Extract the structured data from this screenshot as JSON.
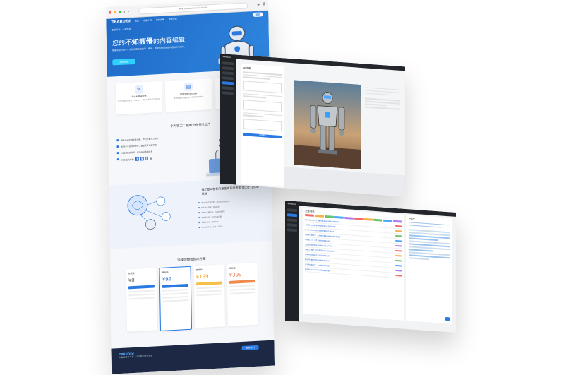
{
  "landing": {
    "url": "www.baiduzz.com/example",
    "logo": "TRAHDEd",
    "nav": [
      "首页",
      "功能介绍",
      "价格方案",
      "帮助中心"
    ],
    "nav_button": "登录",
    "hero_kicker": "智能写作 · 一键生成",
    "hero_title_pre": "您的",
    "hero_title_bold": "不知疲倦",
    "hero_title_post": "的内容编辑",
    "hero_desc": "智能AI写作助手，支持批量生成文章、图片，帮助您高效完成内容创作与发布。",
    "hero_cta": "立即体验",
    "features": [
      {
        "title": "专业AI智能写作",
        "desc": "基于大模型的智能写作能力，一键生成高质量文章内容",
        "icon": "pen-icon"
      },
      {
        "title": "批量生成SEO文章",
        "desc": "支持关键词批量生成，自动发布到网站",
        "icon": "doc-icon"
      },
      {
        "title": "AI绘画图片生成",
        "desc": "输入描述即可生成精美配图",
        "icon": "image-icon"
      }
    ],
    "section2_title": "一个内容工厂能帮您做些什么？",
    "section2_items": [
      "每天自动生成文章内容，节约大量人力成本",
      "支持多平台同步发布，覆盖更多流量渠道",
      "关键词智能拓展，提升网站收录排名"
    ],
    "counter_label": "已生成文章数",
    "counter_digits": [
      "3",
      "9",
      "6"
    ],
    "counter_unit": "篇",
    "robot_bubble": "帮您做内容 提高效率",
    "section3_title": "我们是AI智能文章生成系统专家 致力于让您更高效",
    "section3_items": [
      "支持多种文章类型，满足各类内容需求",
      "智能图文混排，自动配图",
      "支持长文章生成，内容结构清晰",
      "原创度检测，保证内容质量",
      "多语言支持，轻松出海",
      "API接口开放，方便二次开发"
    ],
    "section4_title": "选择你想要的AI方案",
    "plans": [
      {
        "name": "免费版",
        "price": "¥0"
      },
      {
        "name": "基础版",
        "price": "¥99"
      },
      {
        "name": "高级版",
        "price": "¥199"
      },
      {
        "name": "企业版",
        "price": "¥399"
      }
    ],
    "footer_logo": "TRAHDEd",
    "footer_text": "AI智能写作平台 · 让内容创作更简单",
    "footer_button": "联系我们"
  },
  "editor": {
    "brand": "TRAHDEd",
    "panel_title": "AI绘图",
    "generate_label": "生成图片",
    "sidebar_count": 7
  },
  "articles": {
    "brand": "TRAHDEd",
    "panel_title": "文章列表",
    "rows": [
      "如何利用AI写作工具提升网站SEO排名的完整指南",
      "人工智能在内容营销中的应用与未来发展趋势",
      "五个步骤教你快速打造高质量原创文章内容",
      "关键词布局技巧：让你的文章更容易被搜索引擎收录",
      "AI绘画入门：从零开始生成精美配图",
      "企业如何借助智能写作降低内容生产成本",
      "内容工厂模式下的批量写作与自动发布策略",
      "长尾关键词挖掘方法与实战案例分析",
      "网站内容更新频率对搜索排名的影响",
      "多平台内容分发：一次创作全网覆盖",
      "如何评估AI生成内容的原创度与质量"
    ],
    "chat_title": "AI助手",
    "tag_colors": [
      "#f36b6b",
      "#f6b04a",
      "#6bc46b",
      "#4ea7ff",
      "#b07cf0",
      "#f36b6b",
      "#f6b04a",
      "#6bc46b",
      "#4ea7ff",
      "#b07cf0"
    ]
  }
}
